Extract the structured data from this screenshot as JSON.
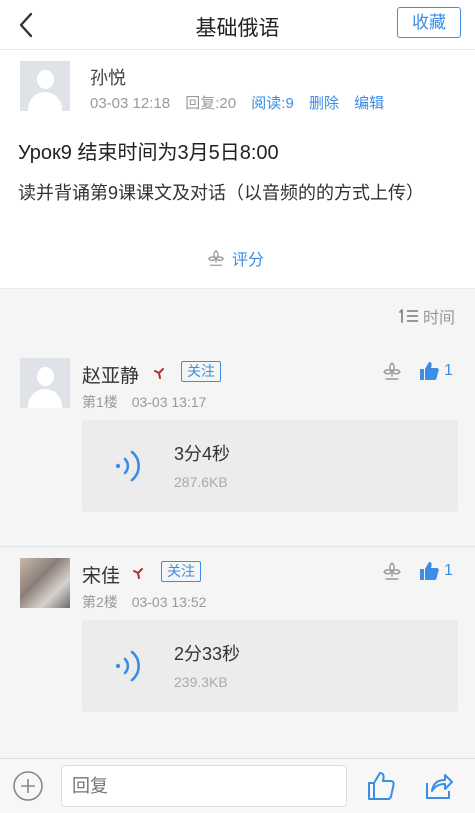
{
  "header": {
    "title": "基础俄语",
    "favorite_label": "收藏"
  },
  "post": {
    "author": "孙悦",
    "date": "03-03 12:18",
    "reply_count": "回复:20",
    "read_count": "阅读:9",
    "delete_label": "删除",
    "edit_label": "编辑",
    "title": "Урок9  结束时间为3月5日8:00",
    "body": "读并背诵第9课课文及对话（以音频的的方式上传）",
    "rate_label": "评分"
  },
  "comments_section": {
    "sort_label": "时间",
    "items": [
      {
        "name": "赵亚静",
        "follow_label": "关注",
        "floor": "第1楼",
        "time": "03-03 13:17",
        "likes": "1",
        "audio_duration": "3分4秒",
        "audio_size": "287.6KB"
      },
      {
        "name": "宋佳",
        "follow_label": "关注",
        "floor": "第2楼",
        "time": "03-03 13:52",
        "likes": "1",
        "audio_duration": "2分33秒",
        "audio_size": "239.3KB"
      }
    ]
  },
  "bottom_bar": {
    "reply_placeholder": "回复"
  },
  "icons": [
    "back-icon",
    "default-avatar-icon",
    "flower-icon",
    "sort-icon",
    "gender-icon",
    "thumbs-up-icon",
    "audio-wave-icon",
    "plus-icon",
    "share-icon"
  ],
  "colors": {
    "accent": "#3a8ee6",
    "background": "#f5f5f5",
    "meta_text": "#9a9a9a"
  }
}
